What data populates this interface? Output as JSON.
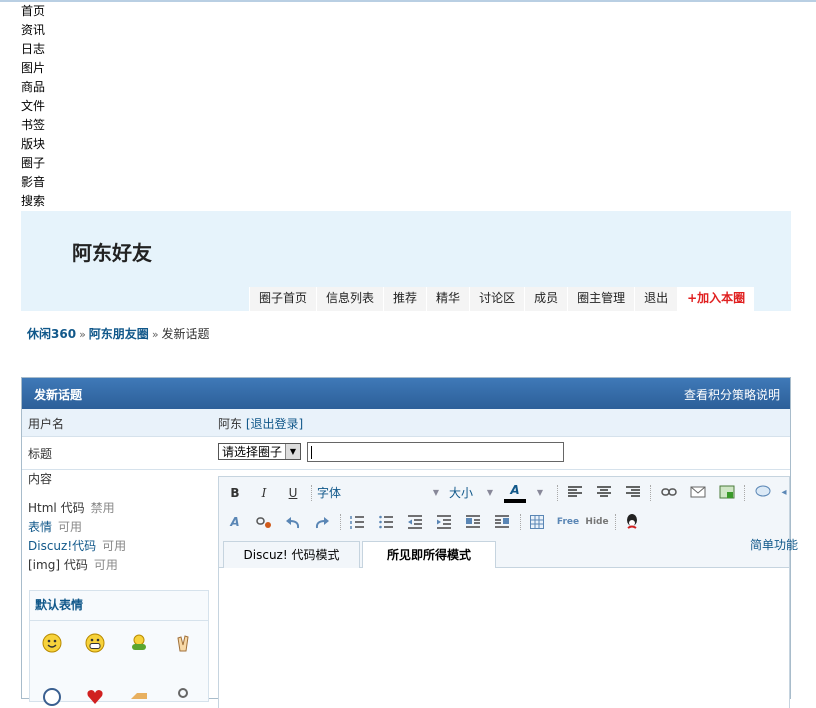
{
  "nav": [
    "首页",
    "资讯",
    "日志",
    "图片",
    "商品",
    "文件",
    "书签",
    "版块",
    "圈子",
    "影音",
    "搜索"
  ],
  "banner": {
    "title": "阿东好友"
  },
  "group_nav": [
    "圈子首页",
    "信息列表",
    "推荐",
    "精华",
    "讨论区",
    "成员",
    "圈主管理",
    "退出"
  ],
  "group_nav_join": "+加入本圈",
  "breadcrumb": {
    "site": "休闲360",
    "sep": "»",
    "group": "阿东朋友圈",
    "current": "发新话题"
  },
  "panel": {
    "title": "发新话题",
    "policy_link": "查看积分策略说明",
    "username_label": "用户名",
    "username": "阿东",
    "logout": "退出登录",
    "subject_label": "标题",
    "subject_select": "请选择圈子",
    "content_label": "内容",
    "html_code": "Html 代码",
    "html_status": "禁用",
    "emoticon": "表情",
    "emoticon_status": "可用",
    "discuz_code": "Discuz!代码",
    "discuz_status": "可用",
    "img_code": "[img] 代码",
    "img_status": "可用",
    "smilies_title": "默认表情"
  },
  "editor": {
    "font_label": "字体",
    "size_label": "大小",
    "tab_code": "Discuz! 代码模式",
    "tab_wysiwyg": "所见即所得模式",
    "simple_mode": "简单功能",
    "free_label": "Free",
    "hide_label": "Hide"
  }
}
